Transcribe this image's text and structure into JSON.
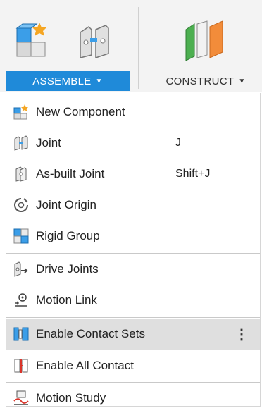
{
  "toolbar": {
    "tabs": [
      {
        "label": "ASSEMBLE",
        "active": true
      },
      {
        "label": "CONSTRUCT",
        "active": false
      }
    ],
    "icons": [
      "new-component-large-icon",
      "joint-large-icon",
      "construct-plane-large-icon"
    ],
    "active_tab_color": "#1f8ad9"
  },
  "menu": {
    "items": [
      {
        "label": "New Component",
        "shortcut": "",
        "icon": "new-component-icon"
      },
      {
        "label": "Joint",
        "shortcut": "J",
        "icon": "joint-icon"
      },
      {
        "label": "As-built Joint",
        "shortcut": "Shift+J",
        "icon": "as-built-joint-icon"
      },
      {
        "label": "Joint Origin",
        "shortcut": "",
        "icon": "joint-origin-icon"
      },
      {
        "label": "Rigid Group",
        "shortcut": "",
        "icon": "rigid-group-icon"
      },
      {
        "label": "Drive Joints",
        "shortcut": "",
        "icon": "drive-joints-icon"
      },
      {
        "label": "Motion Link",
        "shortcut": "",
        "icon": "motion-link-icon"
      },
      {
        "label": "Enable Contact Sets",
        "shortcut": "",
        "icon": "enable-contact-sets-icon",
        "highlighted": true
      },
      {
        "label": "Enable All Contact",
        "shortcut": "",
        "icon": "enable-all-contact-icon"
      },
      {
        "label": "Motion Study",
        "shortcut": "",
        "icon": "motion-study-icon"
      }
    ],
    "more_glyph": "⋮"
  }
}
